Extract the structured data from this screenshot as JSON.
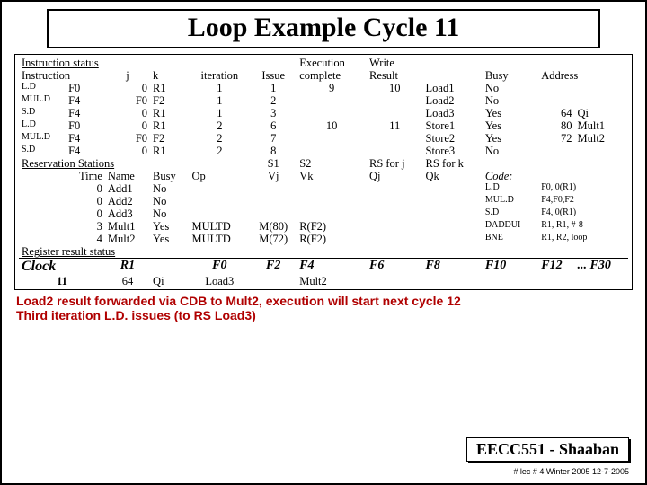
{
  "title": "Loop Example Cycle 11",
  "hdr": {
    "istat": "Instruction status",
    "exec": "Execution",
    "write": "Write",
    "instr": "Instruction",
    "j": "j",
    "k": "k",
    "iter": "iteration",
    "issue": "Issue",
    "complete": "complete",
    "result": "Result",
    "busy": "Busy",
    "addr": "Address"
  },
  "ins": [
    {
      "op": "L.D",
      "dst": "F0",
      "j": "0",
      "k": "R1",
      "iter": "1",
      "issue": "1",
      "comp": "9",
      "res": "10",
      "fu": "Load1",
      "busy": "No",
      "addr": ""
    },
    {
      "op": "MUL.D",
      "dst": "F4",
      "j": "F0",
      "k": "F2",
      "iter": "1",
      "issue": "2",
      "comp": "",
      "res": "",
      "fu": "Load2",
      "busy": "No",
      "addr": ""
    },
    {
      "op": "S.D",
      "dst": "F4",
      "j": "0",
      "k": "R1",
      "iter": "1",
      "issue": "3",
      "comp": "",
      "res": "",
      "fu": "Load3",
      "busy": "Yes",
      "addr": "64",
      "addrq": "Qi"
    },
    {
      "op": "L.D",
      "dst": "F0",
      "j": "0",
      "k": "R1",
      "iter": "2",
      "issue": "6",
      "comp": "10",
      "res": "11",
      "fu": "Store1",
      "busy": "Yes",
      "addr": "80",
      "addrq": "Mult1"
    },
    {
      "op": "MUL.D",
      "dst": "F4",
      "j": "F0",
      "k": "F2",
      "iter": "2",
      "issue": "7",
      "comp": "",
      "res": "",
      "fu": "Store2",
      "busy": "Yes",
      "addr": "72",
      "addrq": "Mult2"
    },
    {
      "op": "S.D",
      "dst": "F4",
      "j": "0",
      "k": "R1",
      "iter": "2",
      "issue": "8",
      "comp": "",
      "res": "",
      "fu": "Store3",
      "busy": "No",
      "addr": ""
    }
  ],
  "rs_hdr": {
    "title": "Reservation Stations",
    "s1": "S1",
    "s2": "S2",
    "rsj": "RS for j",
    "rsk": "RS for k"
  },
  "rs_cols": {
    "time": "Time",
    "name": "Name",
    "busy": "Busy",
    "op": "Op",
    "vj": "Vj",
    "vk": "Vk",
    "qj": "Qj",
    "qk": "Qk",
    "code": "Code:"
  },
  "rs": [
    {
      "time": "0",
      "name": "Add1",
      "busy": "No",
      "op": "",
      "vj": "",
      "vk": "",
      "qj": "",
      "qk": ""
    },
    {
      "time": "0",
      "name": "Add2",
      "busy": "No",
      "op": "",
      "vj": "",
      "vk": "",
      "qj": "",
      "qk": ""
    },
    {
      "time": "0",
      "name": "Add3",
      "busy": "No",
      "op": "",
      "vj": "",
      "vk": "",
      "qj": "",
      "qk": ""
    },
    {
      "time": "3",
      "name": "Mult1",
      "busy": "Yes",
      "op": "MULTD",
      "vj": "M(80)",
      "vk": "R(F2)",
      "qj": "",
      "qk": ""
    },
    {
      "time": "4",
      "name": "Mult2",
      "busy": "Yes",
      "op": "MULTD",
      "vj": "M(72)",
      "vk": "R(F2)",
      "qj": "",
      "qk": ""
    }
  ],
  "code": [
    {
      "op": "L.D",
      "args": "F0, 0(R1)"
    },
    {
      "op": "MUL.D",
      "args": "F4,F0,F2"
    },
    {
      "op": "S.D",
      "args": "F4, 0(R1)"
    },
    {
      "op": "DADDUI",
      "args": "R1, R1, #-8"
    },
    {
      "op": "BNE",
      "args": "R1, R2, loop"
    }
  ],
  "regstat": "Register result status",
  "clock": {
    "label": "Clock",
    "reg": "R1",
    "f": [
      "F0",
      "F2",
      "F4",
      "F6",
      "F8",
      "F10",
      "F12",
      "...",
      "F30"
    ],
    "val": "11",
    "r1": "64",
    "qi": "Qi",
    "row": [
      "Load3",
      "",
      "Mult2",
      "",
      "",
      "",
      "",
      "",
      ""
    ]
  },
  "notes": {
    "l1": "Load2 result forwarded via CDB to Mult2, execution will start next cycle 12",
    "l2": "Third iteration L.D. issues (to RS Load3)"
  },
  "footer": {
    "box": "EECC551 - Shaaban",
    "small": "#  lec # 4  Winter 2005    12-7-2005"
  }
}
